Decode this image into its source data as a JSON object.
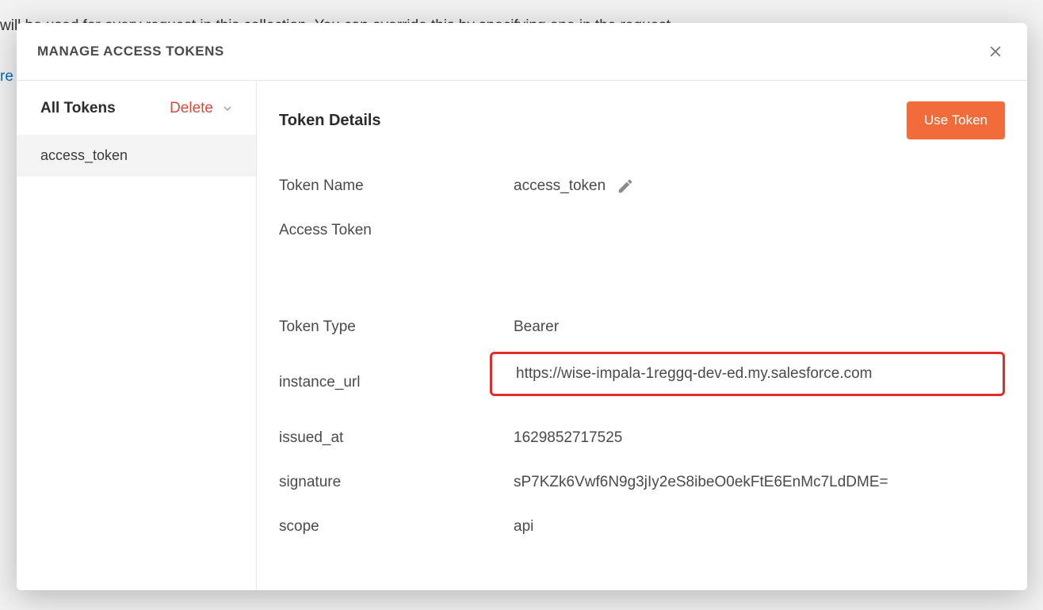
{
  "background": {
    "line": "will be used for every request in this collection. You can override this by specifying one in the request.",
    "link_fragment": "re"
  },
  "modal": {
    "title": "MANAGE ACCESS TOKENS"
  },
  "sidebar": {
    "all_tokens_label": "All Tokens",
    "delete_label": "Delete",
    "tokens": [
      {
        "name": "access_token"
      }
    ]
  },
  "details": {
    "heading": "Token Details",
    "use_token_label": "Use Token",
    "rows": {
      "token_name_label": "Token Name",
      "token_name_value": "access_token",
      "access_token_label": "Access Token",
      "access_token_value": "",
      "token_type_label": "Token Type",
      "token_type_value": "Bearer",
      "instance_url_label": "instance_url",
      "instance_url_value": "https://wise-impala-1reggq-dev-ed.my.salesforce.com",
      "issued_at_label": "issued_at",
      "issued_at_value": "1629852717525",
      "signature_label": "signature",
      "signature_value": "sP7KZk6Vwf6N9g3jIy2eS8ibeO0ekFtE6EnMc7LdDME=",
      "scope_label": "scope",
      "scope_value": "api"
    }
  }
}
